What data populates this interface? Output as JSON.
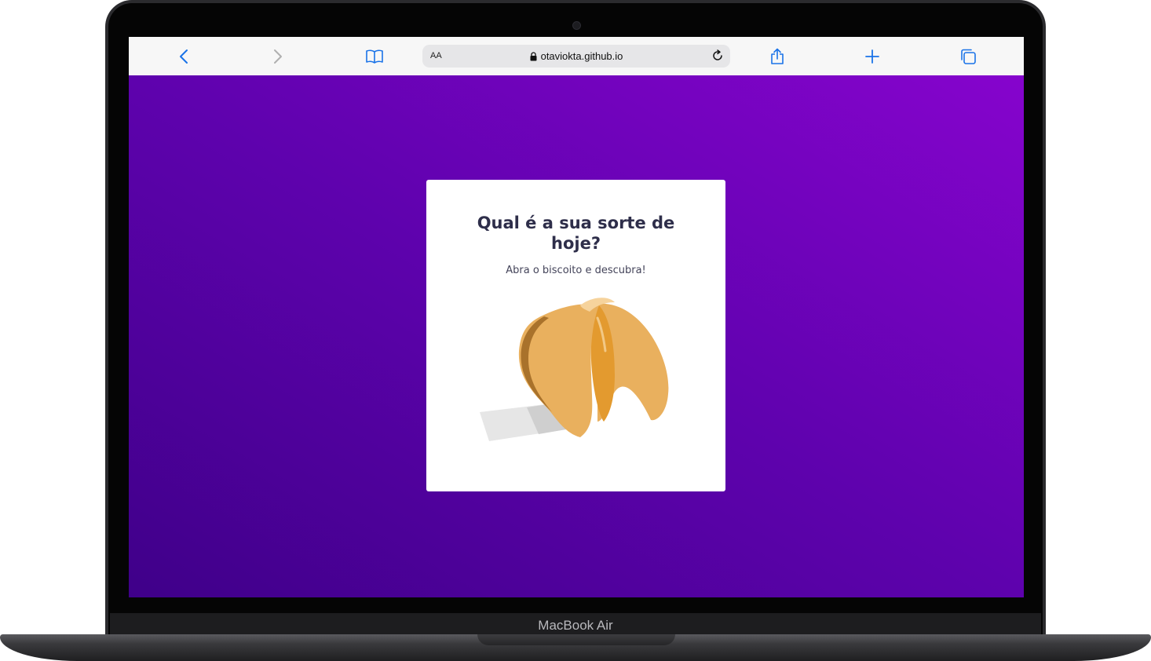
{
  "device": {
    "model_label": "MacBook Air"
  },
  "browser": {
    "reader_label": "AA",
    "url": "otaviokta.github.io",
    "accent_color": "#1a73e8",
    "icons": [
      "back-icon",
      "forward-icon",
      "bookmarks-icon",
      "lock-icon",
      "reload-icon",
      "share-icon",
      "new-tab-icon",
      "tabs-icon"
    ]
  },
  "page": {
    "background_colors": [
      "#3f0089",
      "#8604cd"
    ],
    "card": {
      "title": "Qual é a sua sorte de hoje?",
      "subtitle": "Abra o biscoito e descubra!",
      "image": "fortune-cookie"
    }
  }
}
